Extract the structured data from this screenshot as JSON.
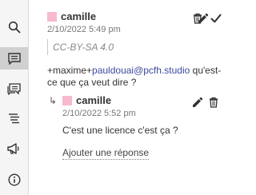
{
  "sidebar": {
    "items": [
      {
        "icon": "search-icon",
        "active": false
      },
      {
        "icon": "comment-icon",
        "active": true
      },
      {
        "icon": "chat-icon",
        "active": false
      },
      {
        "icon": "text-list-icon",
        "active": false
      },
      {
        "icon": "megaphone-icon",
        "active": false
      },
      {
        "icon": "info-icon",
        "active": false
      }
    ]
  },
  "thread": {
    "comment": {
      "author": "camille",
      "author_color": "#f8b8d0",
      "date": "2/10/2022 5:49 pm",
      "quote": "CC-BY-SA 4.0",
      "text_prefix": "+maxime+",
      "mention": "pauldouai@pcfh.studio",
      "text_suffix": " qu'est-ce que ça veut dire ?"
    },
    "reply": {
      "author": "camille",
      "author_color": "#f8b8d0",
      "date": "2/10/2022 5:52 pm",
      "text": "C'est une licence c'est ça ?"
    },
    "add_reply_label": "Ajouter une réponse"
  }
}
